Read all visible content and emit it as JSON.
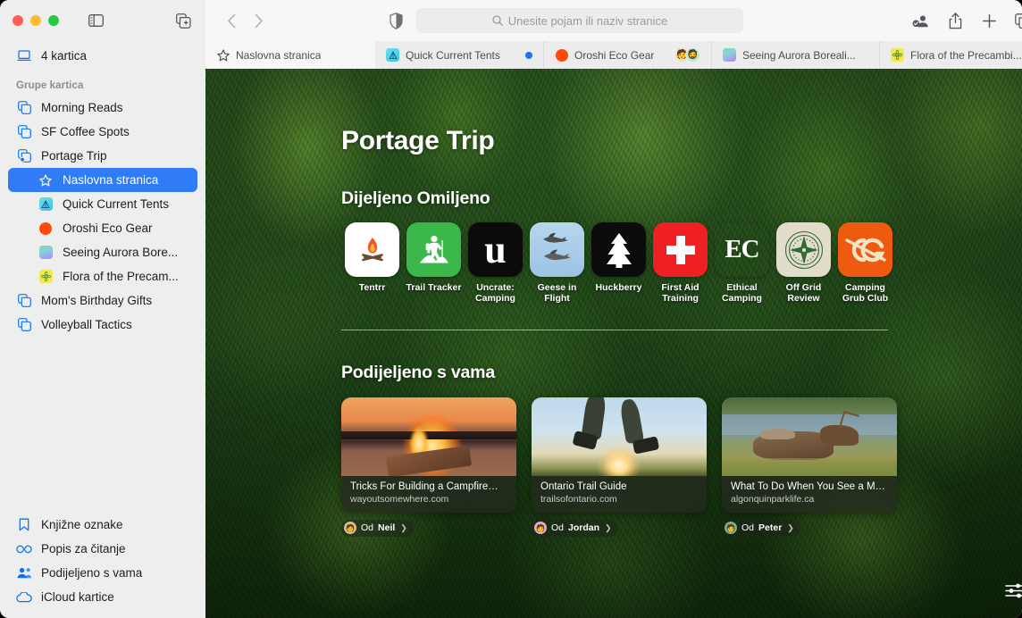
{
  "window": {
    "traffic": [
      "close",
      "minimize",
      "zoom"
    ]
  },
  "sidebar": {
    "toggle_icon": "sidebar-toggle-icon",
    "newtabgroup_icon": "new-tab-group-icon",
    "tabs_count_label": "4 kartica",
    "group_header": "Grupe kartica",
    "groups": [
      {
        "label": "Morning Reads",
        "icon": "tab-group-icon"
      },
      {
        "label": "SF Coffee Spots",
        "icon": "tab-group-icon"
      },
      {
        "label": "Portage Trip",
        "icon": "tab-group-shared-icon"
      }
    ],
    "portage_children": [
      {
        "label": "Naslovna stranica",
        "icon": "star-icon",
        "selected": true
      },
      {
        "label": "Quick Current Tents",
        "icon": "favicon-tent",
        "color": "#4fd3e0"
      },
      {
        "label": "Oroshi Eco Gear",
        "icon": "favicon-circle",
        "color": "#ff4a0a"
      },
      {
        "label": "Seeing Aurora Bore...",
        "icon": "favicon-aurora",
        "color": "#7ee3b6"
      },
      {
        "label": "Flora of the Precam...",
        "icon": "favicon-flora",
        "color": "#f2e94b"
      }
    ],
    "groups_after": [
      {
        "label": "Mom's Birthday Gifts",
        "icon": "tab-group-icon"
      },
      {
        "label": "Volleyball Tactics",
        "icon": "tab-group-icon"
      }
    ],
    "bottom_items": [
      {
        "label": "Knjižne oznake",
        "icon": "bookmark-icon"
      },
      {
        "label": "Popis za čitanje",
        "icon": "reading-list-icon"
      },
      {
        "label": "Podijeljeno s vama",
        "icon": "shared-with-you-icon"
      },
      {
        "label": "iCloud kartice",
        "icon": "icloud-icon"
      }
    ]
  },
  "toolbar": {
    "back_icon": "chevron-left-icon",
    "forward_icon": "chevron-right-icon",
    "shield_icon": "privacy-shield-icon",
    "search_placeholder": "Unesite pojam ili naziv stranice",
    "search_icon": "search-icon",
    "right_icons": [
      {
        "name": "shared-with-you-profile-icon"
      },
      {
        "name": "share-icon"
      },
      {
        "name": "new-tab-plus-icon"
      },
      {
        "name": "tab-overview-icon"
      }
    ]
  },
  "tabbar": {
    "tabs": [
      {
        "label": "Naslovna stranica",
        "icon": "star-icon",
        "active": true,
        "badge": ""
      },
      {
        "label": "Quick Current Tents",
        "icon": "favicon-tent",
        "color": "#4fd3e0",
        "badge": "blue-dot"
      },
      {
        "label": "Oroshi Eco Gear",
        "icon": "favicon-circle",
        "color": "#ff4a0a",
        "badge": "memoji-pair"
      },
      {
        "label": "Seeing Aurora Boreali...",
        "icon": "favicon-aurora",
        "color": "#7ee3b6",
        "badge": ""
      },
      {
        "label": "Flora of the Precambi...",
        "icon": "favicon-flora",
        "color": "#f2e94b",
        "badge": "blue-dot"
      }
    ]
  },
  "page": {
    "title": "Portage Trip",
    "favorites_heading": "Dijeljeno Omiljeno",
    "favorites": [
      {
        "label": "Tentrr",
        "icon": "campfire-icon",
        "bg": "#ffffff",
        "fg": "#f0591f"
      },
      {
        "label": "Trail Tracker",
        "icon": "hiker-icon",
        "bg": "#3cb84b",
        "fg": "#ffffff"
      },
      {
        "label": "Uncrate: Camping",
        "icon": "letter-u-icon",
        "bg": "#0b0b0b",
        "fg": "#ffffff"
      },
      {
        "label": "Geese in Flight",
        "icon": "geese-icon",
        "bg": "#a8cbe8",
        "fg": "#45484a"
      },
      {
        "label": "Huckberry",
        "icon": "pine-tree-icon",
        "bg": "#0b0b0b",
        "fg": "#ffffff"
      },
      {
        "label": "First Aid Training",
        "icon": "first-aid-icon",
        "bg": "#ef2024",
        "fg": "#ffffff"
      },
      {
        "label": "Ethical Camping",
        "icon": "letters-ec-icon",
        "bg": "#0e4a34",
        "fg": "#ffffff"
      },
      {
        "label": "Off Grid Review",
        "icon": "compass-icon",
        "bg": "#e3dccb",
        "fg": "#2f6b33"
      },
      {
        "label": "Camping Grub Club",
        "icon": "letters-cg-icon",
        "bg": "#ee5a10",
        "fg": "#f2e4c4"
      }
    ],
    "shared_heading": "Podijeljeno s vama",
    "shared_cards": [
      {
        "title": "Tricks For Building a Campfire—F...",
        "url": "wayoutsomewhere.com",
        "from_prefix": "Od",
        "from_name": "Neil",
        "avatar_bg": "#e2b98a",
        "image": "campfire-photo"
      },
      {
        "title": "Ontario Trail Guide",
        "url": "trailsofontario.com",
        "from_prefix": "Od",
        "from_name": "Jordan",
        "avatar_bg": "#f0a8c0",
        "image": "hiker-sunset-photo"
      },
      {
        "title": "What To Do When You See a Moo...",
        "url": "algonquinparklife.ca",
        "from_prefix": "Od",
        "from_name": "Peter",
        "avatar_bg": "#7fae7f",
        "image": "elk-pond-photo"
      }
    ],
    "settings_icon": "page-settings-sliders-icon"
  },
  "colors": {
    "accent": "#2f7cf6",
    "sidebar_bg": "#eeeeee",
    "toolbar_bg": "#f7f7f7",
    "tabbar_bg": "#ececec",
    "blue_dot": "#1877f2"
  }
}
